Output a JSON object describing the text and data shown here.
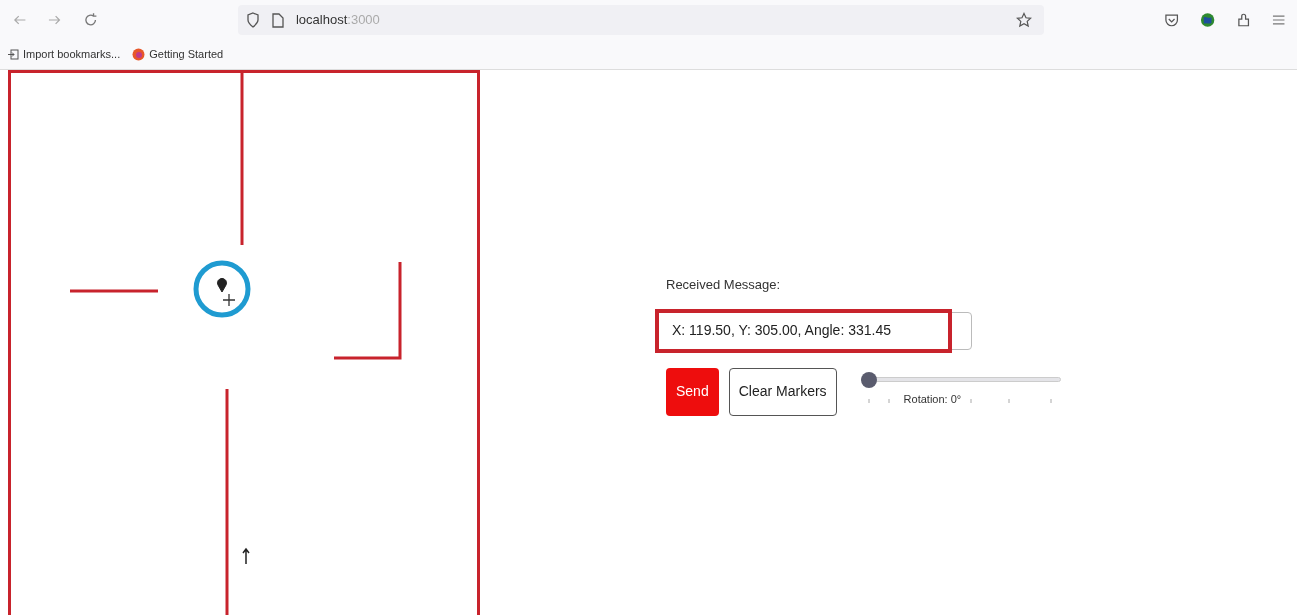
{
  "browser": {
    "url_host": "localhost",
    "url_port": ":3000"
  },
  "bookmarks": [
    {
      "label": "Import bookmarks..."
    },
    {
      "label": "Getting Started"
    }
  ],
  "panel": {
    "label": "Received Message:",
    "message": "X: 119.50, Y: 305.00, Angle: 331.45",
    "buttons": [
      {
        "label": "Send",
        "kind": "primary"
      },
      {
        "label": "Clear Markers",
        "kind": "outline"
      }
    ],
    "rotation": {
      "level": 0,
      "label": "Rotation: 0°"
    }
  }
}
